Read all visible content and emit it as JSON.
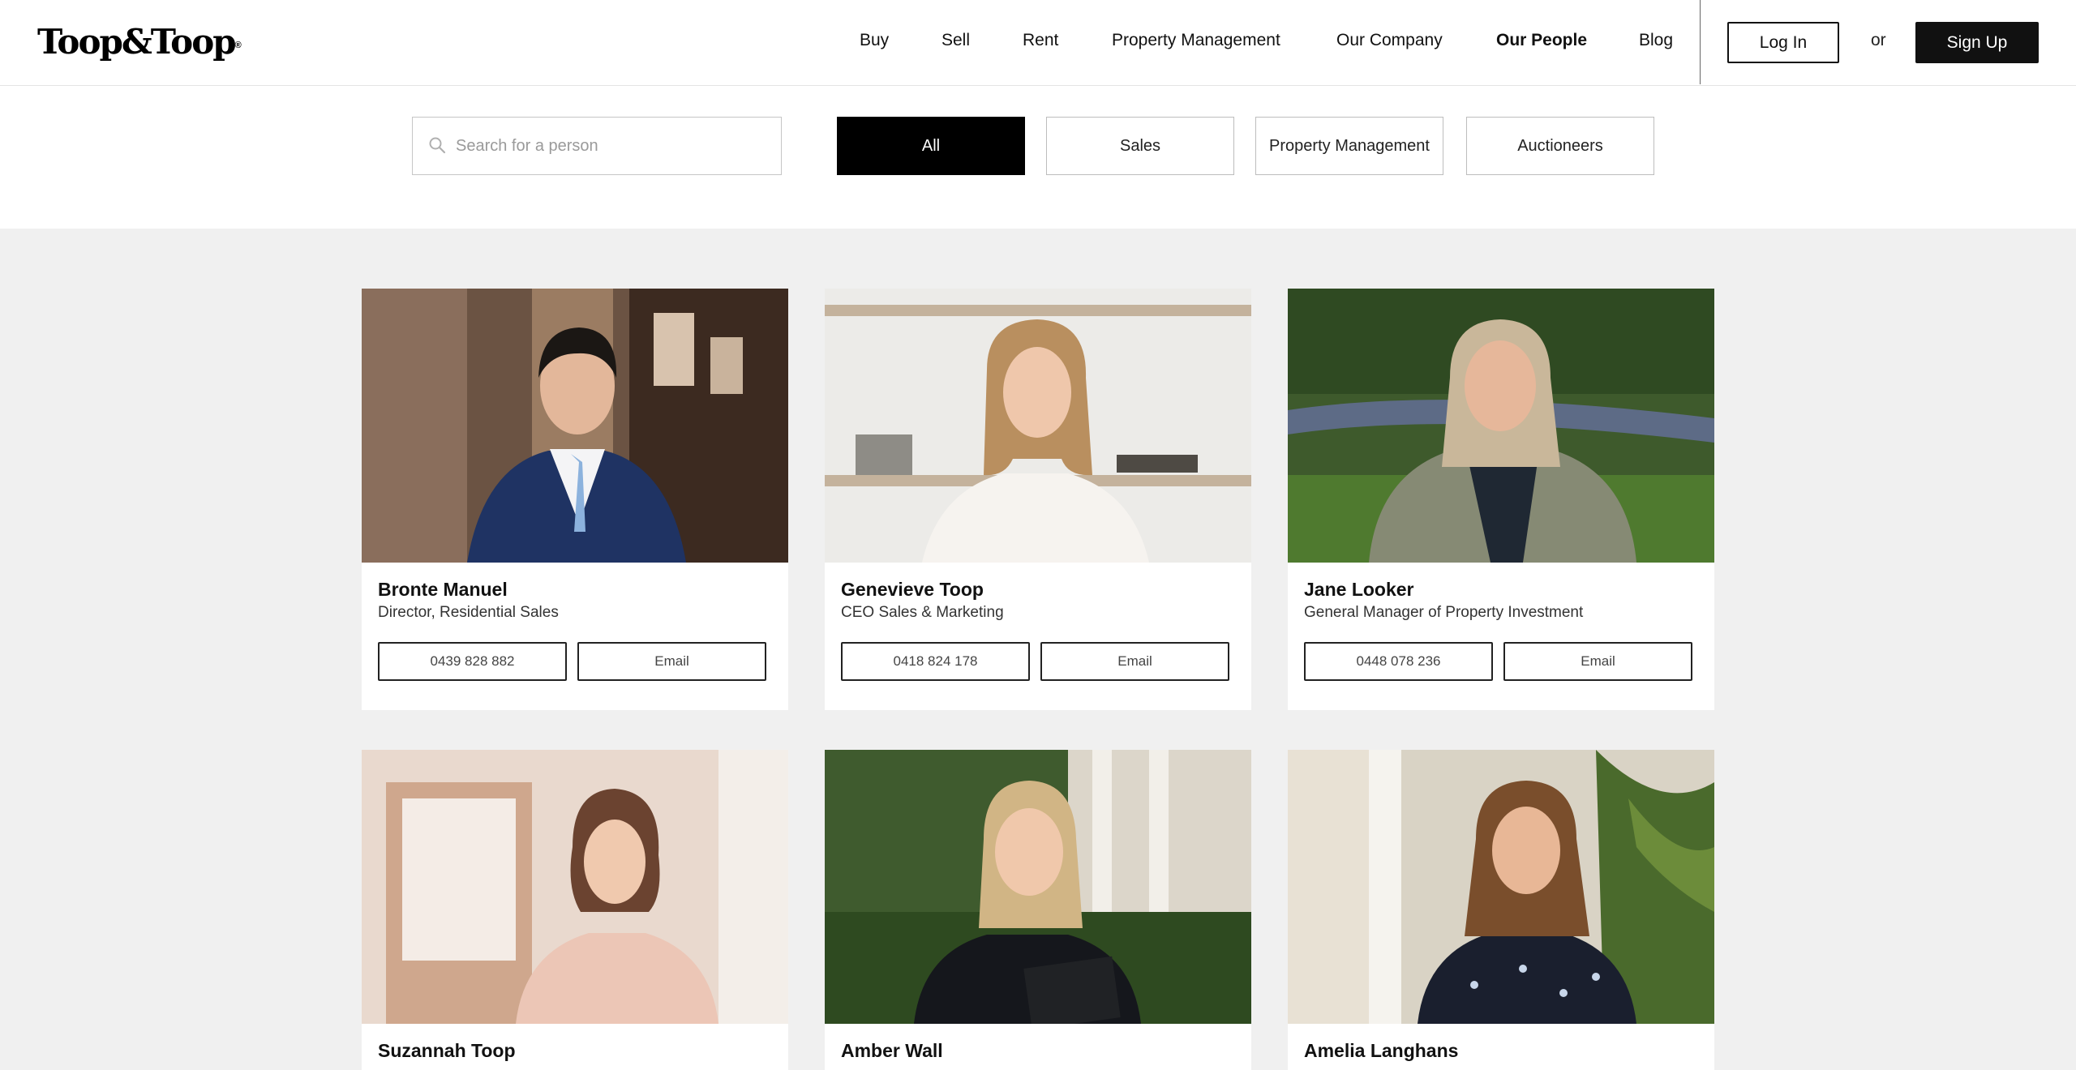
{
  "header": {
    "logo_text": "Toop&Toop",
    "logo_mark": "®",
    "nav": [
      {
        "label": "Buy"
      },
      {
        "label": "Sell"
      },
      {
        "label": "Rent"
      },
      {
        "label": "Property Management"
      },
      {
        "label": "Our Company"
      },
      {
        "label": "Our People",
        "active": true
      },
      {
        "label": "Blog"
      }
    ],
    "login_label": "Log In",
    "or_label": "or",
    "signup_label": "Sign Up"
  },
  "filters": {
    "search_placeholder": "Search for a person",
    "search_value": "",
    "options": [
      {
        "label": "All",
        "active": true
      },
      {
        "label": "Sales"
      },
      {
        "label": "Property Management"
      },
      {
        "label": "Auctioneers"
      }
    ]
  },
  "people": [
    {
      "name": "Bronte Manuel",
      "role": "Director, Residential Sales",
      "phone": "0439 828 882",
      "email_label": "Email"
    },
    {
      "name": "Genevieve Toop",
      "role": "CEO Sales & Marketing",
      "phone": "0418 824 178",
      "email_label": "Email"
    },
    {
      "name": "Jane Looker",
      "role": "General Manager of Property Investment",
      "phone": "0448 078 236",
      "email_label": "Email"
    },
    {
      "name": "Suzannah Toop",
      "role": "",
      "phone": "",
      "email_label": ""
    },
    {
      "name": "Amber Wall",
      "role": "",
      "phone": "",
      "email_label": ""
    },
    {
      "name": "Amelia Langhans",
      "role": "",
      "phone": "",
      "email_label": ""
    }
  ],
  "colors": {
    "page_background": "#f0f0f0",
    "active_filter": "#000000",
    "brand_text": "#000000"
  }
}
